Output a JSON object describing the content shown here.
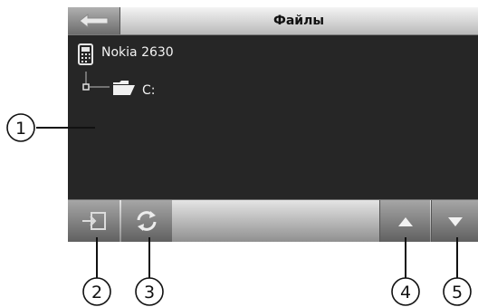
{
  "header": {
    "title": "Файлы"
  },
  "tree": {
    "device": "Nokia 2630",
    "drive": "C:"
  },
  "callouts": [
    "1",
    "2",
    "3",
    "4",
    "5"
  ],
  "icons": {
    "back": "back-arrow-icon",
    "device": "phone-icon",
    "drive": "folder-icon",
    "export": "export-icon",
    "refresh": "refresh-icon",
    "up": "arrow-up-icon",
    "down": "arrow-down-icon"
  }
}
